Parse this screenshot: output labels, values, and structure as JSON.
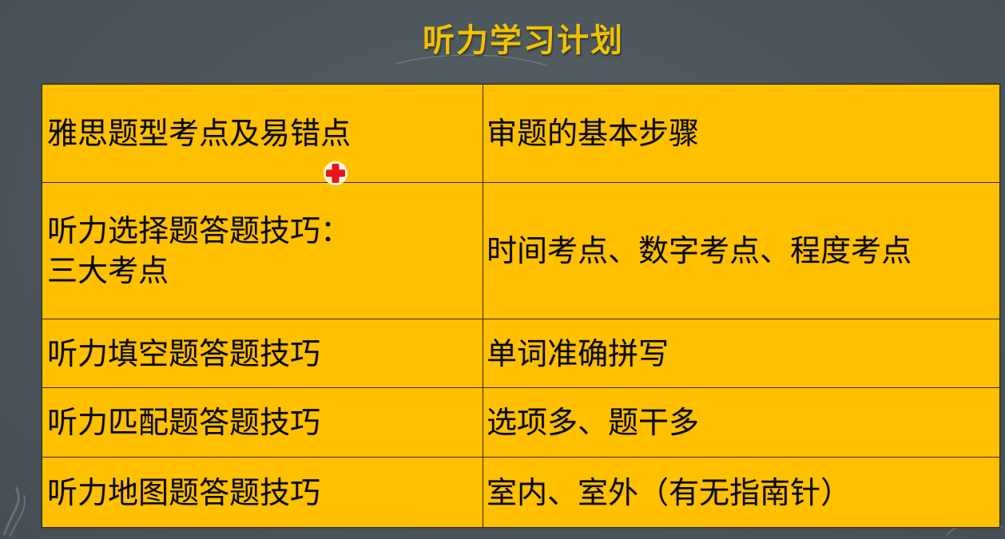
{
  "slide": {
    "title": "听力学习计划"
  },
  "table": {
    "rows": [
      {
        "left": [
          "雅思题型考点及易错点"
        ],
        "right": "审题的基本步骤"
      },
      {
        "left": [
          "听力选择题答题技巧：",
          "三大考点"
        ],
        "right": "时间考点、数字考点、程度考点"
      },
      {
        "left": [
          "听力填空题答题技巧"
        ],
        "right": "单词准确拼写"
      },
      {
        "left": [
          "听力匹配题答题技巧"
        ],
        "right": "选项多、题干多"
      },
      {
        "left": [
          "听力地图题答题技巧"
        ],
        "right": "室内、室外（有无指南针）"
      }
    ]
  },
  "colors": {
    "background": "#4c565b",
    "title": "#f2c200",
    "table_fill": "#ffc000",
    "cursor": "#e8141b"
  },
  "icons": {
    "cursor": "red-cross-cursor-icon"
  }
}
